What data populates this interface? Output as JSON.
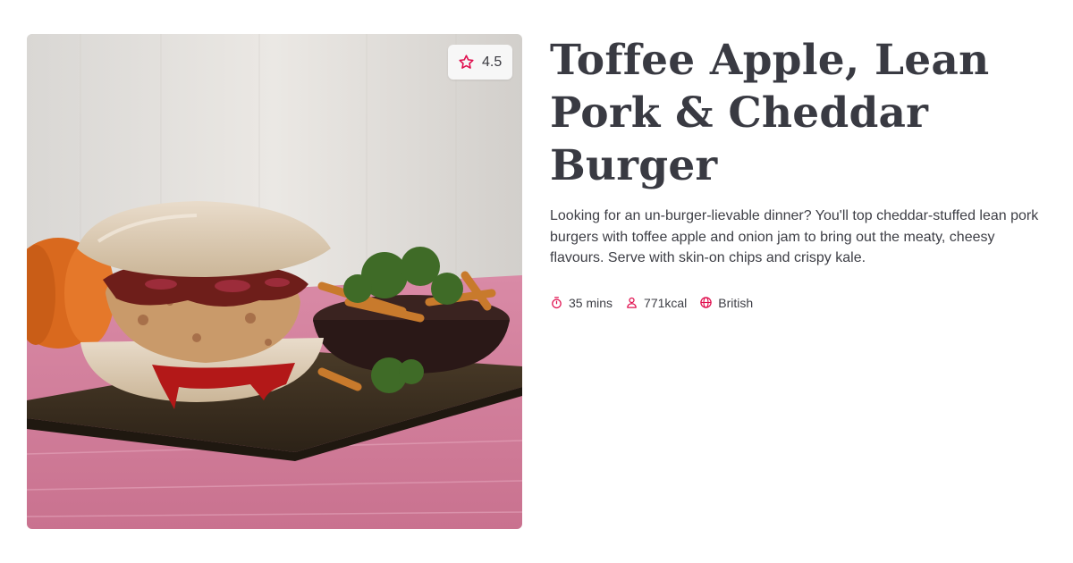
{
  "recipe": {
    "title": "Toffee Apple, Lean Pork & Cheddar Burger",
    "description": "Looking for an un-burger-lievable dinner? You'll top cheddar-stuffed lean pork burgers with toffee apple and onion jam to bring out the meaty, cheesy flavours. Serve with skin-on chips and crispy kale.",
    "rating": "4.5",
    "rating_icon": "star-icon",
    "meta": {
      "time": "35 mins",
      "time_icon": "stopwatch-icon",
      "calories": "771kcal",
      "calories_icon": "person-icon",
      "cuisine": "British",
      "cuisine_icon": "globe-icon"
    }
  },
  "colors": {
    "accent": "#e0104f",
    "title_text": "#393a42",
    "body_text": "#3d3e45",
    "rating_badge_bg": "#f7f7f7"
  }
}
